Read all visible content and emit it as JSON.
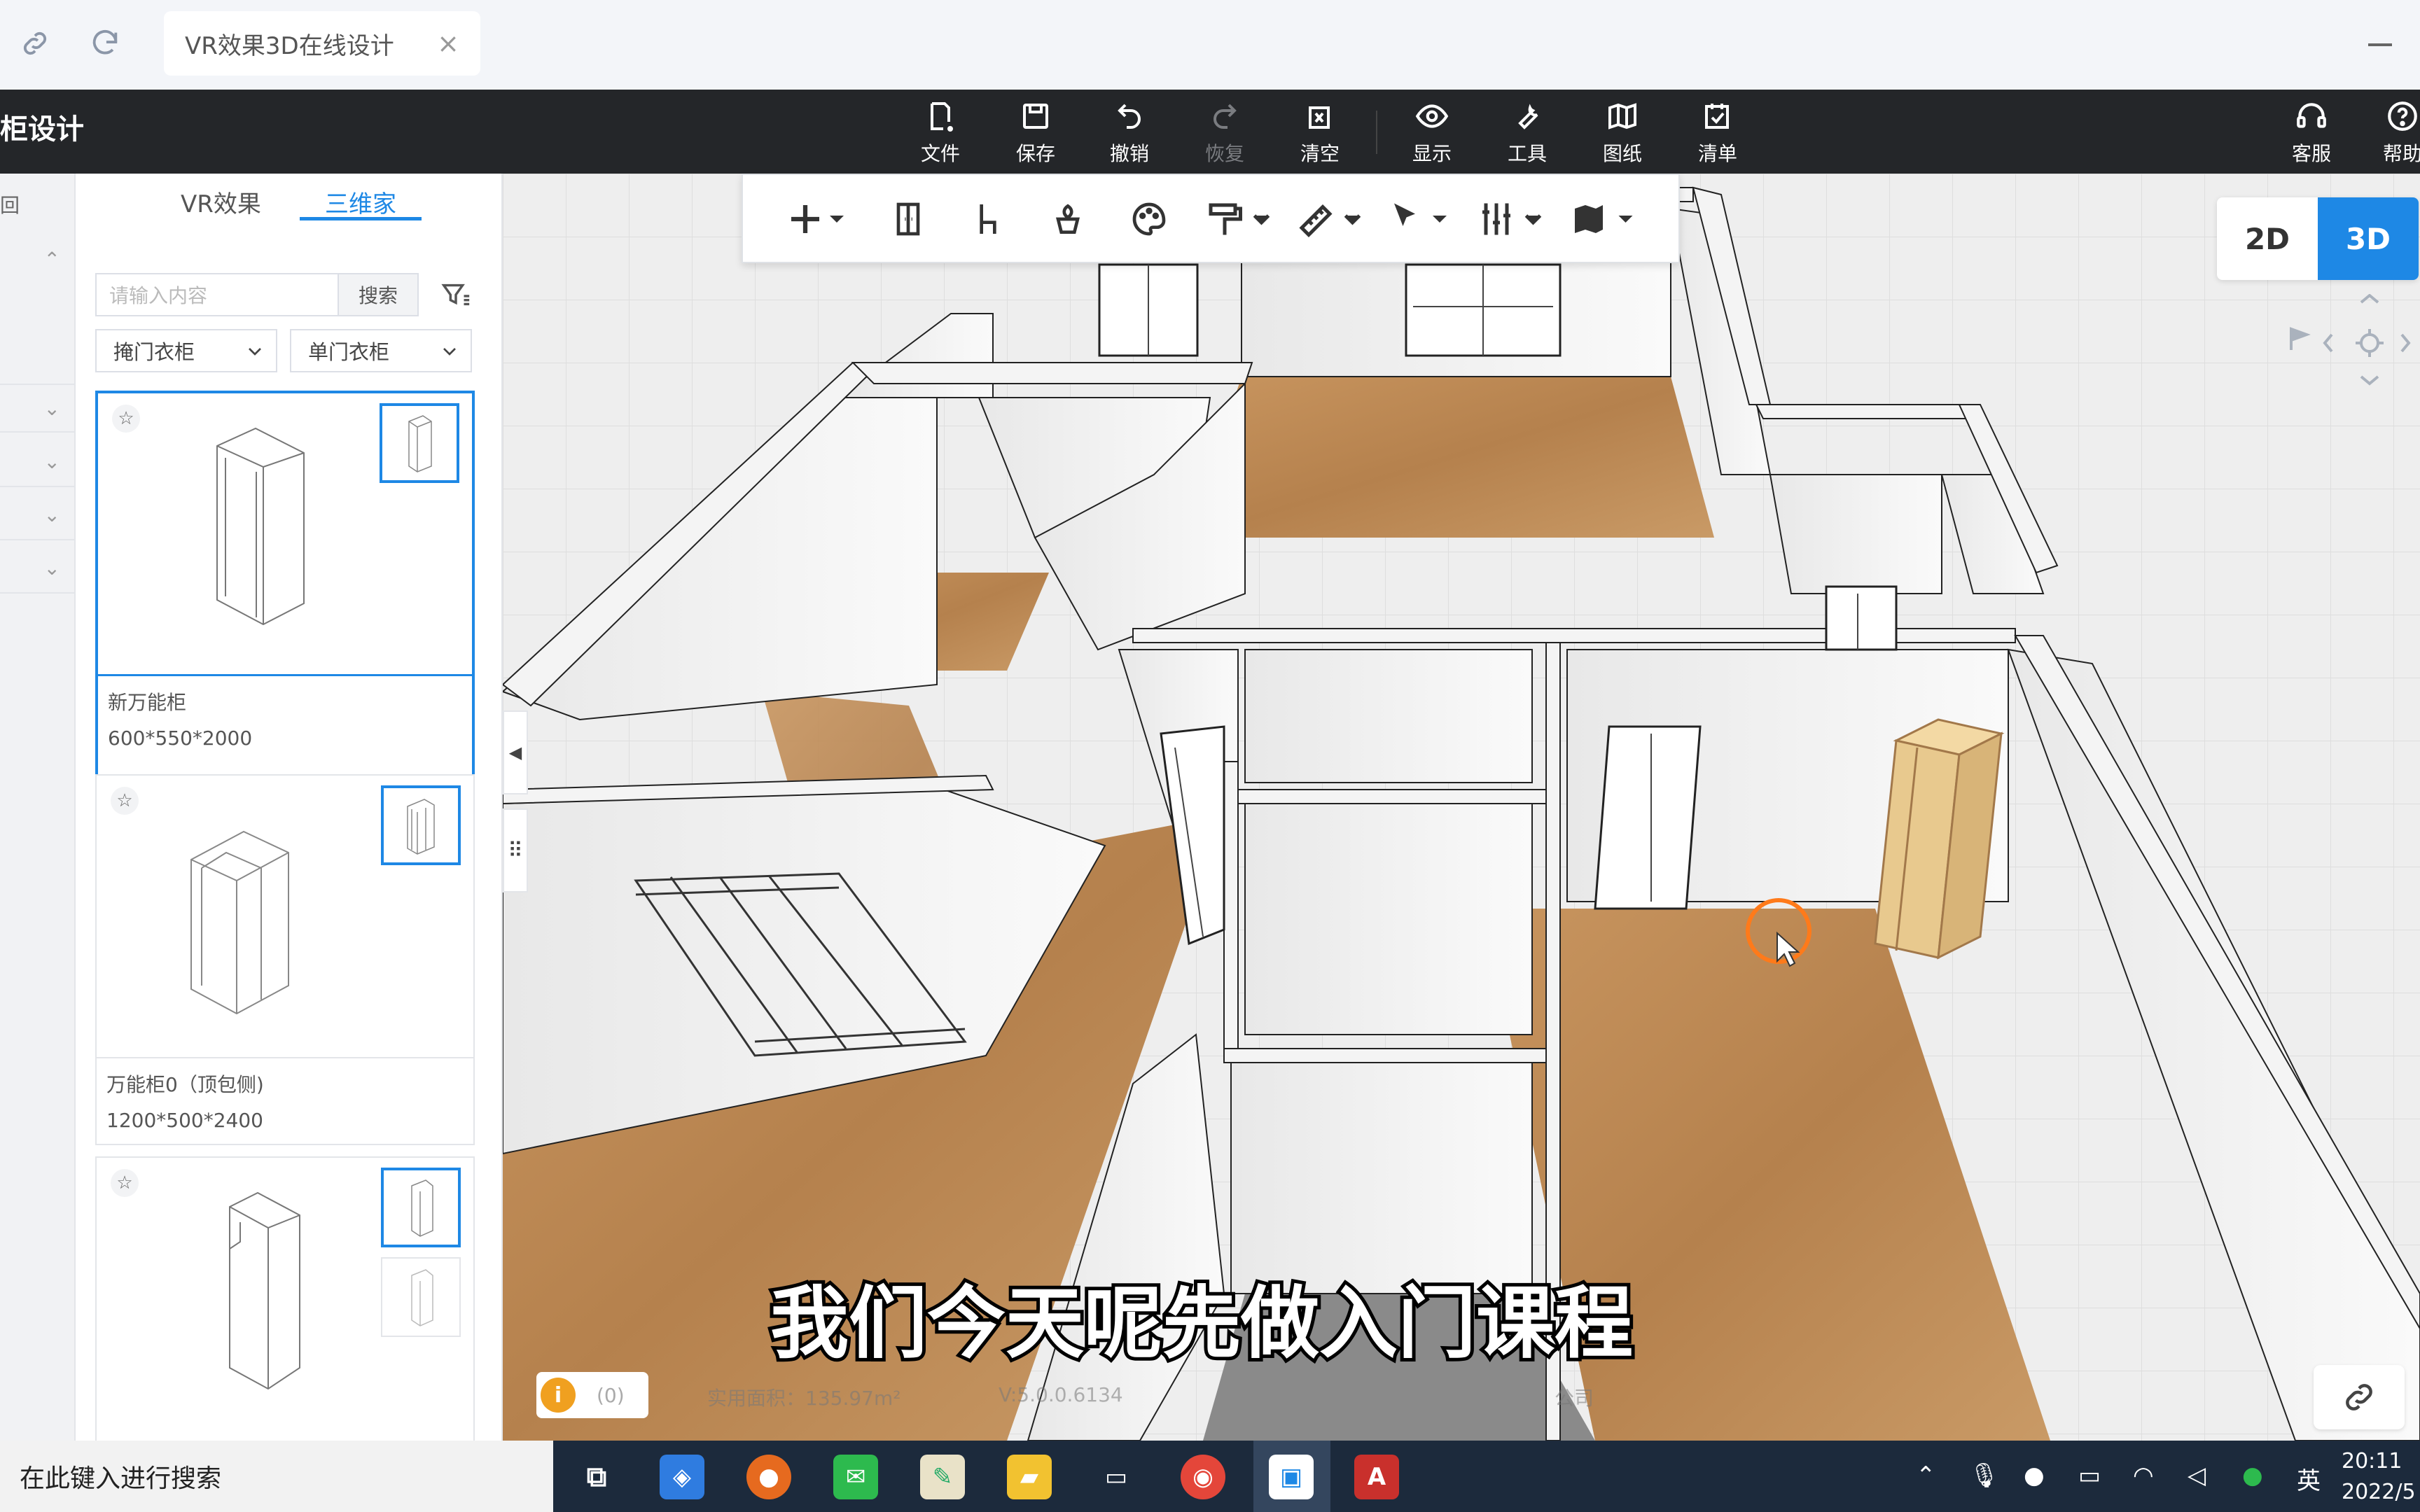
{
  "browser": {
    "tab_title": "VR效果3D在线设计",
    "tab_close": "×"
  },
  "header": {
    "app_title": "柜设计",
    "tools": [
      {
        "label": "文件",
        "icon": "file-icon"
      },
      {
        "label": "保存",
        "icon": "save-icon"
      },
      {
        "label": "撤销",
        "icon": "undo-icon"
      },
      {
        "label": "恢复",
        "icon": "redo-icon",
        "disabled": true
      },
      {
        "label": "清空",
        "icon": "clear-icon"
      },
      {
        "label": "显示",
        "icon": "eye-icon"
      },
      {
        "label": "工具",
        "icon": "wrench-icon"
      },
      {
        "label": "图纸",
        "icon": "drawing-icon"
      },
      {
        "label": "清单",
        "icon": "checklist-icon"
      }
    ],
    "right_tools": [
      {
        "label": "客服",
        "icon": "headset-icon"
      },
      {
        "label": "帮助",
        "icon": "help-icon"
      }
    ]
  },
  "sidebar": {
    "back_label": "回",
    "tabs": [
      {
        "label": "VR效果",
        "active": false
      },
      {
        "label": "三维家",
        "active": true
      }
    ],
    "search": {
      "placeholder": "请输入内容",
      "button": "搜索"
    },
    "filters": [
      {
        "selected": "掩门衣柜"
      },
      {
        "selected": "单门衣柜"
      }
    ],
    "items": [
      {
        "name": "新万能柜",
        "dims": "600*550*2000",
        "selected": true
      },
      {
        "name": "万能柜0（顶包侧)",
        "dims": "1200*500*2400",
        "selected": false
      },
      {
        "name": "",
        "dims": "",
        "selected": false
      }
    ]
  },
  "view_toggle": {
    "two_d": "2D",
    "three_d": "3D",
    "active": "3D"
  },
  "status": {
    "count": "(0)",
    "area": "实用面积：135.97m²",
    "version": "V:5.0.0.6134",
    "company": "公司"
  },
  "subtitle": "我们今天呢先做入门课程",
  "taskbar": {
    "search_placeholder": "在此键入进行搜索",
    "ime": "英",
    "time": "20:11",
    "date": "2022/5"
  },
  "colors": {
    "accent": "#1e88e5",
    "header_bg": "#242629",
    "floor_wood": "#c08a55",
    "cabinet_wood": "#e8c98e",
    "cursor_ring": "#ff7a1a"
  }
}
